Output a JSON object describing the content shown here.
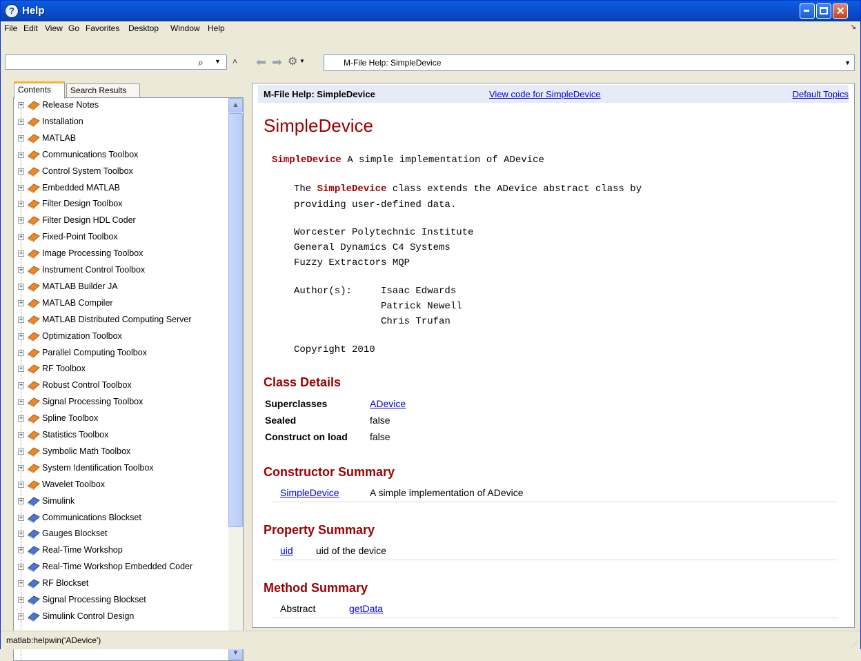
{
  "window": {
    "title": "Help",
    "app_icon": "?",
    "buttons": {
      "min": "_",
      "max": "□",
      "close": "✕"
    }
  },
  "menu": [
    "File",
    "Edit",
    "View",
    "Go",
    "Favorites",
    "Desktop",
    "Window",
    "Help"
  ],
  "menu_overflow": "↘",
  "left": {
    "search_value": "",
    "tabs": [
      "Contents",
      "Search Results"
    ],
    "tree": [
      {
        "label": "Release Notes",
        "book": "orange"
      },
      {
        "label": "Installation",
        "book": "orange"
      },
      {
        "label": "MATLAB",
        "book": "orange"
      },
      {
        "label": "Communications Toolbox",
        "book": "orange"
      },
      {
        "label": "Control System Toolbox",
        "book": "orange"
      },
      {
        "label": "Embedded MATLAB",
        "book": "orange"
      },
      {
        "label": "Filter Design Toolbox",
        "book": "orange"
      },
      {
        "label": "Filter Design HDL Coder",
        "book": "orange"
      },
      {
        "label": "Fixed-Point Toolbox",
        "book": "orange"
      },
      {
        "label": "Image Processing Toolbox",
        "book": "orange"
      },
      {
        "label": "Instrument Control Toolbox",
        "book": "orange"
      },
      {
        "label": "MATLAB Builder JA",
        "book": "orange"
      },
      {
        "label": "MATLAB Compiler",
        "book": "orange"
      },
      {
        "label": "MATLAB Distributed Computing Server",
        "book": "orange"
      },
      {
        "label": "Optimization Toolbox",
        "book": "orange"
      },
      {
        "label": "Parallel Computing Toolbox",
        "book": "orange"
      },
      {
        "label": "RF Toolbox",
        "book": "orange"
      },
      {
        "label": "Robust Control Toolbox",
        "book": "orange"
      },
      {
        "label": "Signal Processing Toolbox",
        "book": "orange"
      },
      {
        "label": "Spline Toolbox",
        "book": "orange"
      },
      {
        "label": "Statistics Toolbox",
        "book": "orange"
      },
      {
        "label": "Symbolic Math Toolbox",
        "book": "orange"
      },
      {
        "label": "System Identification Toolbox",
        "book": "orange"
      },
      {
        "label": "Wavelet Toolbox",
        "book": "orange"
      },
      {
        "label": "Simulink",
        "book": "blue"
      },
      {
        "label": "Communications Blockset",
        "book": "blue"
      },
      {
        "label": "Gauges Blockset",
        "book": "blue"
      },
      {
        "label": "Real-Time Workshop",
        "book": "blue"
      },
      {
        "label": "Real-Time Workshop Embedded Coder",
        "book": "blue"
      },
      {
        "label": "RF Blockset",
        "book": "blue"
      },
      {
        "label": "Signal Processing Blockset",
        "book": "blue"
      },
      {
        "label": "Simulink Control Design",
        "book": "blue"
      }
    ]
  },
  "nav": {
    "address": "M-File Help: SimpleDevice"
  },
  "doc": {
    "header_title": "M-File Help: SimpleDevice",
    "view_code_link": "View code for SimpleDevice",
    "default_topics_link": "Default Topics",
    "title": "SimpleDevice",
    "summary_name": "SimpleDevice",
    "summary_text": " A simple implementation of ADevice",
    "desc_line1_pre": "The ",
    "desc_line1_name": "SimpleDevice",
    "desc_line1_post": " class extends the ADevice abstract class by",
    "desc_line2": "providing user-defined data.",
    "org_lines": [
      "Worcester Polytechnic Institute",
      "General Dynamics C4 Systems",
      "Fuzzy Extractors MQP"
    ],
    "authors_label": "Author(s):",
    "authors": [
      "Isaac Edwards",
      "Patrick Newell",
      "Chris Trufan"
    ],
    "copyright": "Copyright 2010",
    "class_details_heading": "Class Details",
    "class_details": [
      {
        "key": "Superclasses",
        "value": "ADevice",
        "link": true
      },
      {
        "key": "Sealed",
        "value": "false",
        "link": false
      },
      {
        "key": "Construct on load",
        "value": "false",
        "link": false
      }
    ],
    "constructor_heading": "Constructor Summary",
    "constructor": {
      "name": "SimpleDevice",
      "desc": "A simple implementation of ADevice"
    },
    "property_heading": "Property Summary",
    "property": {
      "name": "uid",
      "desc": "uid of the device"
    },
    "method_heading": "Method Summary",
    "method": {
      "qualifier": "Abstract",
      "name": "getData"
    }
  },
  "status": "matlab:helpwin('ADevice')",
  "colors": {
    "heading": "#990000",
    "link": "#0000cc",
    "titlebar": "#0a5fdc"
  }
}
